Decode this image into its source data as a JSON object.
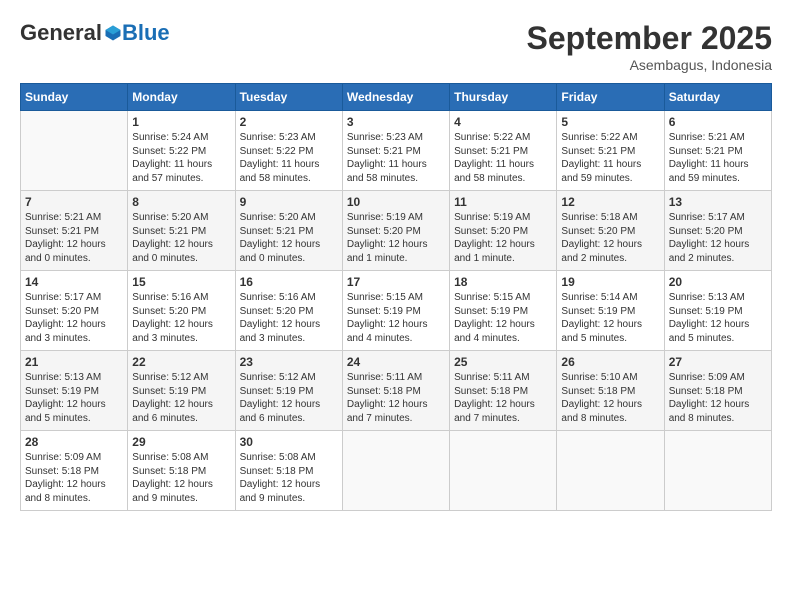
{
  "header": {
    "logo_general": "General",
    "logo_blue": "Blue",
    "month": "September 2025",
    "location": "Asembagus, Indonesia"
  },
  "weekdays": [
    "Sunday",
    "Monday",
    "Tuesday",
    "Wednesday",
    "Thursday",
    "Friday",
    "Saturday"
  ],
  "weeks": [
    [
      {
        "day": "",
        "info": ""
      },
      {
        "day": "1",
        "info": "Sunrise: 5:24 AM\nSunset: 5:22 PM\nDaylight: 11 hours\nand 57 minutes."
      },
      {
        "day": "2",
        "info": "Sunrise: 5:23 AM\nSunset: 5:22 PM\nDaylight: 11 hours\nand 58 minutes."
      },
      {
        "day": "3",
        "info": "Sunrise: 5:23 AM\nSunset: 5:21 PM\nDaylight: 11 hours\nand 58 minutes."
      },
      {
        "day": "4",
        "info": "Sunrise: 5:22 AM\nSunset: 5:21 PM\nDaylight: 11 hours\nand 58 minutes."
      },
      {
        "day": "5",
        "info": "Sunrise: 5:22 AM\nSunset: 5:21 PM\nDaylight: 11 hours\nand 59 minutes."
      },
      {
        "day": "6",
        "info": "Sunrise: 5:21 AM\nSunset: 5:21 PM\nDaylight: 11 hours\nand 59 minutes."
      }
    ],
    [
      {
        "day": "7",
        "info": "Sunrise: 5:21 AM\nSunset: 5:21 PM\nDaylight: 12 hours\nand 0 minutes."
      },
      {
        "day": "8",
        "info": "Sunrise: 5:20 AM\nSunset: 5:21 PM\nDaylight: 12 hours\nand 0 minutes."
      },
      {
        "day": "9",
        "info": "Sunrise: 5:20 AM\nSunset: 5:21 PM\nDaylight: 12 hours\nand 0 minutes."
      },
      {
        "day": "10",
        "info": "Sunrise: 5:19 AM\nSunset: 5:20 PM\nDaylight: 12 hours\nand 1 minute."
      },
      {
        "day": "11",
        "info": "Sunrise: 5:19 AM\nSunset: 5:20 PM\nDaylight: 12 hours\nand 1 minute."
      },
      {
        "day": "12",
        "info": "Sunrise: 5:18 AM\nSunset: 5:20 PM\nDaylight: 12 hours\nand 2 minutes."
      },
      {
        "day": "13",
        "info": "Sunrise: 5:17 AM\nSunset: 5:20 PM\nDaylight: 12 hours\nand 2 minutes."
      }
    ],
    [
      {
        "day": "14",
        "info": "Sunrise: 5:17 AM\nSunset: 5:20 PM\nDaylight: 12 hours\nand 3 minutes."
      },
      {
        "day": "15",
        "info": "Sunrise: 5:16 AM\nSunset: 5:20 PM\nDaylight: 12 hours\nand 3 minutes."
      },
      {
        "day": "16",
        "info": "Sunrise: 5:16 AM\nSunset: 5:20 PM\nDaylight: 12 hours\nand 3 minutes."
      },
      {
        "day": "17",
        "info": "Sunrise: 5:15 AM\nSunset: 5:19 PM\nDaylight: 12 hours\nand 4 minutes."
      },
      {
        "day": "18",
        "info": "Sunrise: 5:15 AM\nSunset: 5:19 PM\nDaylight: 12 hours\nand 4 minutes."
      },
      {
        "day": "19",
        "info": "Sunrise: 5:14 AM\nSunset: 5:19 PM\nDaylight: 12 hours\nand 5 minutes."
      },
      {
        "day": "20",
        "info": "Sunrise: 5:13 AM\nSunset: 5:19 PM\nDaylight: 12 hours\nand 5 minutes."
      }
    ],
    [
      {
        "day": "21",
        "info": "Sunrise: 5:13 AM\nSunset: 5:19 PM\nDaylight: 12 hours\nand 5 minutes."
      },
      {
        "day": "22",
        "info": "Sunrise: 5:12 AM\nSunset: 5:19 PM\nDaylight: 12 hours\nand 6 minutes."
      },
      {
        "day": "23",
        "info": "Sunrise: 5:12 AM\nSunset: 5:19 PM\nDaylight: 12 hours\nand 6 minutes."
      },
      {
        "day": "24",
        "info": "Sunrise: 5:11 AM\nSunset: 5:18 PM\nDaylight: 12 hours\nand 7 minutes."
      },
      {
        "day": "25",
        "info": "Sunrise: 5:11 AM\nSunset: 5:18 PM\nDaylight: 12 hours\nand 7 minutes."
      },
      {
        "day": "26",
        "info": "Sunrise: 5:10 AM\nSunset: 5:18 PM\nDaylight: 12 hours\nand 8 minutes."
      },
      {
        "day": "27",
        "info": "Sunrise: 5:09 AM\nSunset: 5:18 PM\nDaylight: 12 hours\nand 8 minutes."
      }
    ],
    [
      {
        "day": "28",
        "info": "Sunrise: 5:09 AM\nSunset: 5:18 PM\nDaylight: 12 hours\nand 8 minutes."
      },
      {
        "day": "29",
        "info": "Sunrise: 5:08 AM\nSunset: 5:18 PM\nDaylight: 12 hours\nand 9 minutes."
      },
      {
        "day": "30",
        "info": "Sunrise: 5:08 AM\nSunset: 5:18 PM\nDaylight: 12 hours\nand 9 minutes."
      },
      {
        "day": "",
        "info": ""
      },
      {
        "day": "",
        "info": ""
      },
      {
        "day": "",
        "info": ""
      },
      {
        "day": "",
        "info": ""
      }
    ]
  ]
}
